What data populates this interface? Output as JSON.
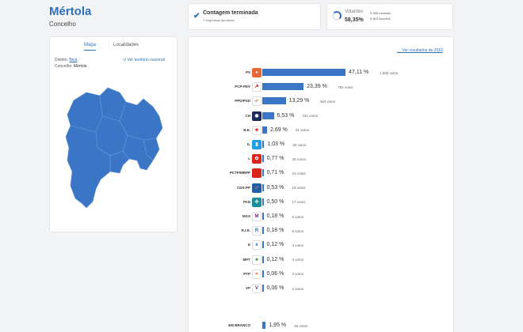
{
  "header": {
    "title": "Mértola",
    "subtitle": "Concelho"
  },
  "status": {
    "title": "Contagem terminada",
    "subtitle": "7 freguesias apuradas"
  },
  "voters": {
    "label": "Votantes",
    "pct": "58,35%",
    "count": "3.386 votantes",
    "registered": "5.803 inscritos"
  },
  "map_panel": {
    "tabs": [
      {
        "label": "Mapa",
        "active": true
      },
      {
        "label": "Localidades",
        "active": false
      }
    ],
    "district_label": "Distrito:",
    "district_value": "Beja",
    "county_label": "Concelho:",
    "county_value": "Mértola",
    "national_link": "Ver território nacional",
    "map_color": "#3b76c6"
  },
  "results": {
    "prev_link": "Ver resultados de 2019",
    "bar_color": "#3b76c6",
    "parties": [
      {
        "name": "PS",
        "pct": 47.11,
        "pct_label": "47,11 %",
        "votes": "1.595 votos",
        "logo": {
          "color": "#e8663a",
          "icon": "circle-icon"
        }
      },
      {
        "name": "PCP-PEV",
        "pct": 23.39,
        "pct_label": "23,39 %",
        "votes": "792 votos",
        "logo": {
          "color": "#ffffff",
          "icon": "hammer-sickle-icon"
        }
      },
      {
        "name": "PPD/PSD",
        "pct": 13.29,
        "pct_label": "13,29 %",
        "votes": "450 votos",
        "logo": {
          "color": "#ffffff",
          "icon": "arrow-icon"
        }
      },
      {
        "name": "CH",
        "pct": 6.53,
        "pct_label": "6,53 %",
        "votes": "221 votos",
        "logo": {
          "color": "#1a2b5c",
          "icon": "chega-icon"
        }
      },
      {
        "name": "B.E.",
        "pct": 2.69,
        "pct_label": "2,69 %",
        "votes": "91 votos",
        "logo": {
          "color": "#ffffff",
          "icon": "star-icon"
        }
      },
      {
        "name": "IL",
        "pct": 1.03,
        "pct_label": "1,03 %",
        "votes": "35 votos",
        "logo": {
          "color": "#1e9fe6",
          "icon": "il-icon"
        }
      },
      {
        "name": "L",
        "pct": 0.77,
        "pct_label": "0,77 %",
        "votes": "26 votos",
        "logo": {
          "color": "#d9251c",
          "icon": "flower-icon"
        }
      },
      {
        "name": "PCTP/MRPP",
        "pct": 0.71,
        "pct_label": "0,71 %",
        "votes": "24 votos",
        "logo": {
          "color": "#d9251c",
          "icon": "hammer-sickle-icon"
        }
      },
      {
        "name": "CDS-PP",
        "pct": 0.53,
        "pct_label": "0,53 %",
        "votes": "18 votos",
        "logo": {
          "color": "#1f5fa8",
          "icon": "arrow-icon"
        }
      },
      {
        "name": "PAN",
        "pct": 0.5,
        "pct_label": "0,50 %",
        "votes": "17 votos",
        "logo": {
          "color": "#1a8f9a",
          "icon": "pan-icon"
        }
      },
      {
        "name": "MAS",
        "pct": 0.18,
        "pct_label": "0,18 %",
        "votes": "6 votos",
        "logo": {
          "color": "#ffffff",
          "icon": "mas-icon"
        }
      },
      {
        "name": "R.I.R.",
        "pct": 0.18,
        "pct_label": "0,18 %",
        "votes": "6 votos",
        "logo": {
          "color": "#ffffff",
          "icon": "rir-icon"
        }
      },
      {
        "name": "E",
        "pct": 0.12,
        "pct_label": "0,12 %",
        "votes": "4 votos",
        "logo": {
          "color": "#ffffff",
          "icon": "ergue-icon"
        }
      },
      {
        "name": "MPT",
        "pct": 0.12,
        "pct_label": "0,12 %",
        "votes": "4 votos",
        "logo": {
          "color": "#ffffff",
          "icon": "clover-icon"
        }
      },
      {
        "name": "PTP",
        "pct": 0.06,
        "pct_label": "0,06 %",
        "votes": "2 votos",
        "logo": {
          "color": "#ffffff",
          "icon": "ptp-icon"
        }
      },
      {
        "name": "VP",
        "pct": 0.06,
        "pct_label": "0,06 %",
        "votes": "2 votos",
        "logo": {
          "color": "#ffffff",
          "icon": "volt-icon"
        }
      }
    ],
    "blank": {
      "name": "EM BRANCO",
      "pct": 1.95,
      "pct_label": "1,95 %",
      "votes": "66 votos"
    }
  }
}
